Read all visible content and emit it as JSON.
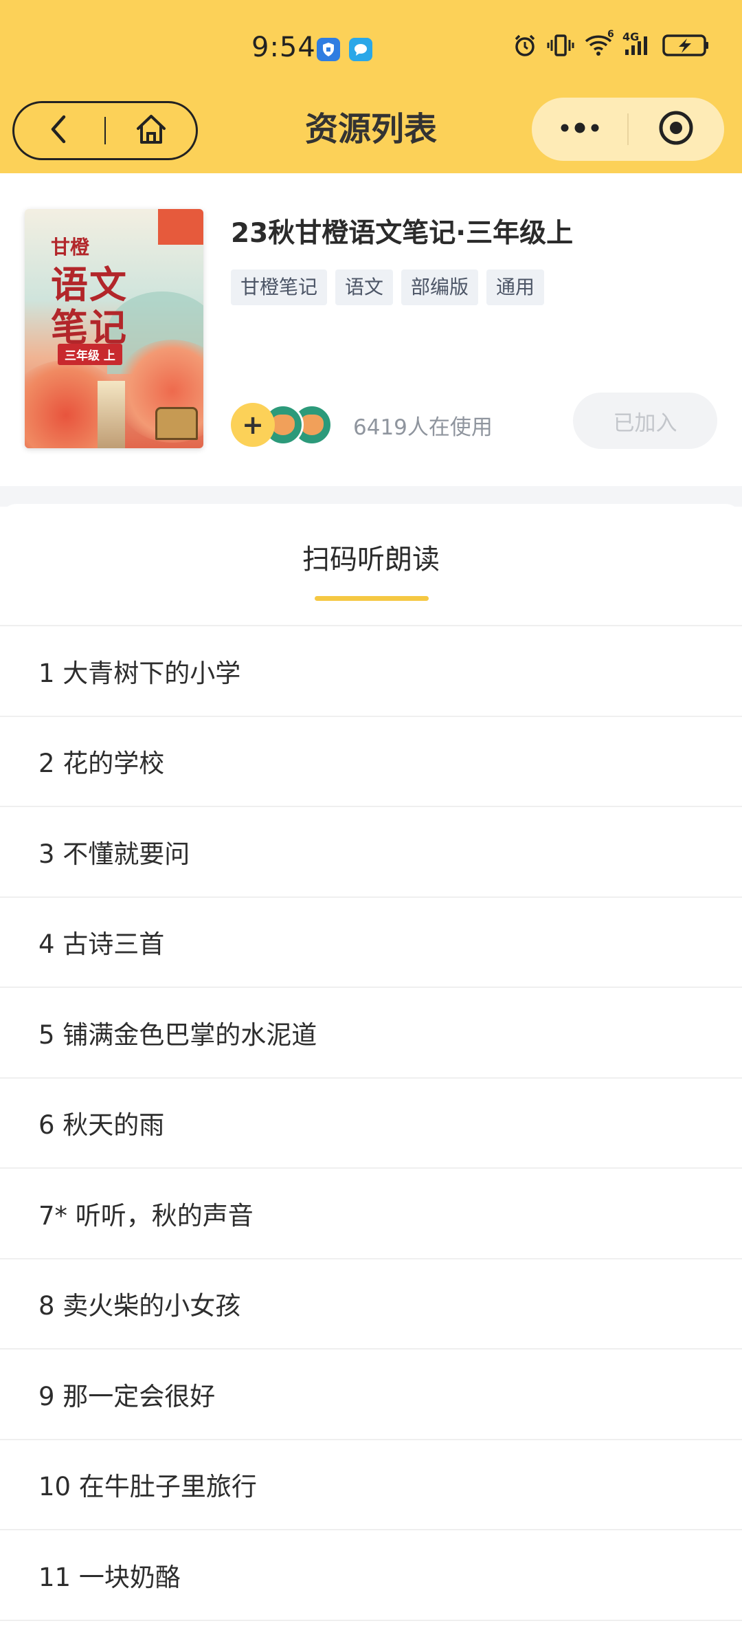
{
  "status_bar": {
    "time": "9:54",
    "network": "4G",
    "sim_marker": "6",
    "icons": [
      "shield-app-icon",
      "message-app-icon",
      "alarm-icon",
      "vibrate-icon",
      "wifi-icon",
      "signal-icon",
      "battery-charging-icon"
    ]
  },
  "nav": {
    "title": "资源列表",
    "back_icon": "chevron-left-icon",
    "home_icon": "home-icon",
    "more_icon": "more-dots-icon",
    "close_icon": "target-icon"
  },
  "book": {
    "title": "23秋甘橙语文笔记·三年级上",
    "tags": [
      "甘橙笔记",
      "语文",
      "部编版",
      "通用"
    ],
    "user_count_text": "6419人在使用",
    "joined_label": "已加入",
    "plus_label": "+",
    "cover": {
      "brand": "甘橙",
      "title_line1": "语文",
      "title_line2": "笔记",
      "grade": "三年级 上"
    }
  },
  "tab": {
    "label": "扫码听朗读"
  },
  "lessons": [
    {
      "label": "1 大青树下的小学"
    },
    {
      "label": "2 花的学校"
    },
    {
      "label": "3 不懂就要问"
    },
    {
      "label": "4 古诗三首"
    },
    {
      "label": "5 铺满金色巴掌的水泥道"
    },
    {
      "label": "6 秋天的雨"
    },
    {
      "label": "7* 听听，秋的声音"
    },
    {
      "label": "8 卖火柴的小女孩"
    },
    {
      "label": "9 那一定会很好"
    },
    {
      "label": "10 在牛肚子里旅行"
    },
    {
      "label": "11 一块奶酪"
    }
  ],
  "colors": {
    "header": "#FCD158",
    "accent": "#F5C843",
    "capsule_right": "#FEEBB6"
  }
}
